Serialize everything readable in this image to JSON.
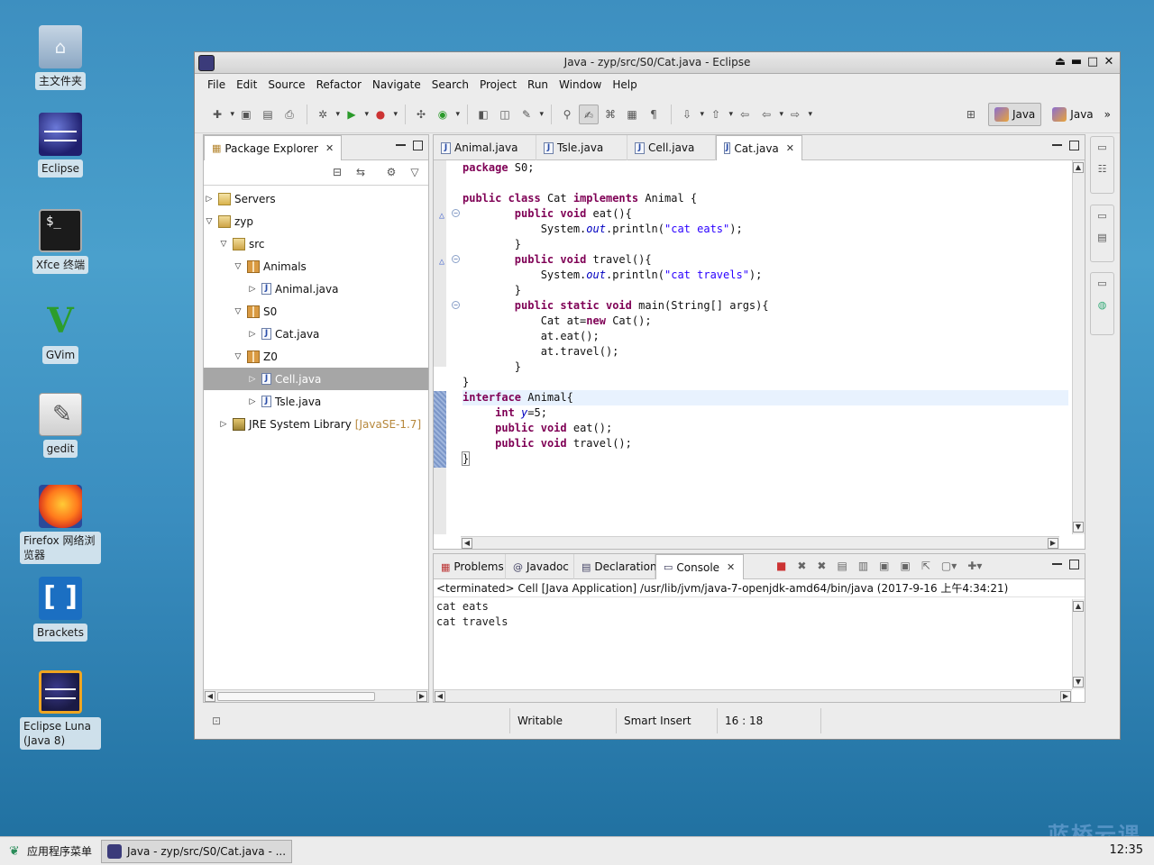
{
  "desktop": {
    "icons": [
      {
        "label": "主文件夹",
        "icon": "home-folder-icon"
      },
      {
        "label": "Eclipse",
        "icon": "eclipse-icon"
      },
      {
        "label": "Xfce 终端",
        "icon": "terminal-icon"
      },
      {
        "label": "GVim",
        "icon": "gvim-icon"
      },
      {
        "label": "gedit",
        "icon": "gedit-icon"
      },
      {
        "label": "Firefox 网络浏览器",
        "icon": "firefox-icon"
      },
      {
        "label": "Brackets",
        "icon": "brackets-icon"
      },
      {
        "label": "Eclipse Luna (Java 8)",
        "icon": "eclipse-luna-icon"
      }
    ],
    "watermark": "蓝桥云课"
  },
  "window": {
    "title": "Java - zyp/src/S0/Cat.java - Eclipse"
  },
  "menu": [
    "File",
    "Edit",
    "Source",
    "Refactor",
    "Navigate",
    "Search",
    "Project",
    "Run",
    "Window",
    "Help"
  ],
  "perspectives": [
    {
      "label": "Java",
      "selected": true
    },
    {
      "label": "Java",
      "selected": false
    }
  ],
  "package_explorer": {
    "title": "Package Explorer",
    "tree": [
      {
        "label": "Servers",
        "level": 0,
        "expanded": false,
        "type": "folder"
      },
      {
        "label": "zyp",
        "level": 0,
        "expanded": true,
        "type": "project"
      },
      {
        "label": "src",
        "level": 1,
        "expanded": true,
        "type": "source-folder"
      },
      {
        "label": "Animals",
        "level": 2,
        "expanded": true,
        "type": "package"
      },
      {
        "label": "Animal.java",
        "level": 3,
        "expanded": false,
        "type": "java-file"
      },
      {
        "label": "S0",
        "level": 2,
        "expanded": true,
        "type": "package"
      },
      {
        "label": "Cat.java",
        "level": 3,
        "expanded": false,
        "type": "java-file"
      },
      {
        "label": "Z0",
        "level": 2,
        "expanded": true,
        "type": "package"
      },
      {
        "label": "Cell.java",
        "level": 3,
        "expanded": false,
        "type": "java-file",
        "selected": true
      },
      {
        "label": "Tsle.java",
        "level": 3,
        "expanded": false,
        "type": "java-file"
      },
      {
        "label": "JRE System Library",
        "decoration": "[JavaSE-1.7]",
        "level": 1,
        "expanded": false,
        "type": "library"
      }
    ]
  },
  "editor": {
    "tabs": [
      {
        "label": "Animal.java",
        "active": false
      },
      {
        "label": "Tsle.java",
        "active": false
      },
      {
        "label": "Cell.java",
        "active": false
      },
      {
        "label": "Cat.java",
        "active": true
      }
    ]
  },
  "console": {
    "tabs": [
      {
        "label": "Problems",
        "active": false
      },
      {
        "label": "Javadoc",
        "active": false
      },
      {
        "label": "Declaration",
        "active": false
      },
      {
        "label": "Console",
        "active": true
      }
    ],
    "info": "<terminated> Cell [Java Application] /usr/lib/jvm/java-7-openjdk-amd64/bin/java (2017-9-16 上午4:34:21)",
    "output": [
      "cat eats",
      "cat travels"
    ]
  },
  "status": {
    "writable": "Writable",
    "insert_mode": "Smart Insert",
    "position": "16 : 18"
  },
  "taskbar": {
    "start_label": "应用程序菜单",
    "task_label": "Java - zyp/src/S0/Cat.java - ...",
    "clock": "12:35"
  }
}
